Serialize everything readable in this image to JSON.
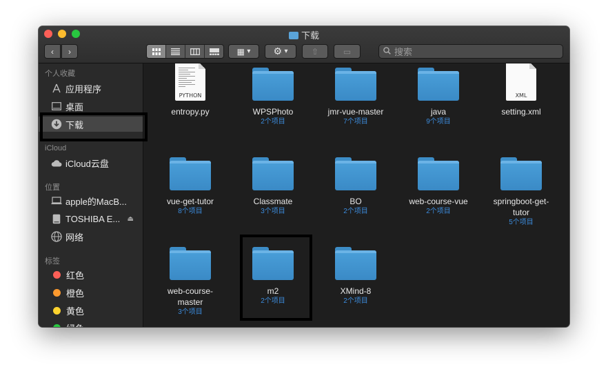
{
  "window": {
    "title": "下载"
  },
  "toolbar": {
    "back_glyph": "‹",
    "forward_glyph": "›",
    "view_icons": [
      "icon-view",
      "list-view",
      "column-view",
      "gallery-view"
    ],
    "group_glyph": "▦",
    "action_glyph": "⚙",
    "share_glyph": "⇧",
    "tag_glyph": "▭",
    "dropdown_glyph": "▾"
  },
  "search": {
    "placeholder": "搜索"
  },
  "sidebar": {
    "favorites_header": "个人收藏",
    "favorites": [
      {
        "label": "应用程序",
        "icon": "applications-icon"
      },
      {
        "label": "桌面",
        "icon": "desktop-icon"
      },
      {
        "label": "下载",
        "icon": "downloads-icon",
        "selected": true
      }
    ],
    "icloud_header": "iCloud",
    "icloud": [
      {
        "label": "iCloud云盘",
        "icon": "cloud-icon"
      }
    ],
    "locations_header": "位置",
    "locations": [
      {
        "label": "apple的MacB...",
        "icon": "laptop-icon"
      },
      {
        "label": "TOSHIBA E...",
        "icon": "drive-icon"
      },
      {
        "label": "网络",
        "icon": "network-icon"
      }
    ],
    "tags_header": "标签",
    "tags": [
      {
        "label": "红色",
        "color": "#fc5f57"
      },
      {
        "label": "橙色",
        "color": "#fd9a2e"
      },
      {
        "label": "黄色",
        "color": "#fdd32e"
      },
      {
        "label": "绿色",
        "color": "#28c840"
      }
    ]
  },
  "files": [
    {
      "name": "entropy.py",
      "kind": "doc",
      "ext": "PYTHON",
      "count": ""
    },
    {
      "name": "WPSPhoto",
      "kind": "folder",
      "count": "2个项目"
    },
    {
      "name": "jmr-vue-master",
      "kind": "folder",
      "count": "7个项目"
    },
    {
      "name": "java",
      "kind": "folder",
      "count": "9个项目"
    },
    {
      "name": "setting.xml",
      "kind": "doc",
      "ext": "XML",
      "count": ""
    },
    {
      "name": "vue-get-tutor",
      "kind": "folder",
      "count": "8个项目"
    },
    {
      "name": "Classmate",
      "kind": "folder",
      "count": "3个项目"
    },
    {
      "name": "BO",
      "kind": "folder",
      "count": "2个项目"
    },
    {
      "name": "web-course-vue",
      "kind": "folder",
      "count": "2个项目"
    },
    {
      "name": "springboot-get-tutor",
      "kind": "folder",
      "count": "5个项目"
    },
    {
      "name": "web-course-master",
      "kind": "folder",
      "count": "3个项目"
    },
    {
      "name": "m2",
      "kind": "folder",
      "count": "2个项目"
    },
    {
      "name": "XMind-8",
      "kind": "folder",
      "count": "2个项目"
    }
  ]
}
